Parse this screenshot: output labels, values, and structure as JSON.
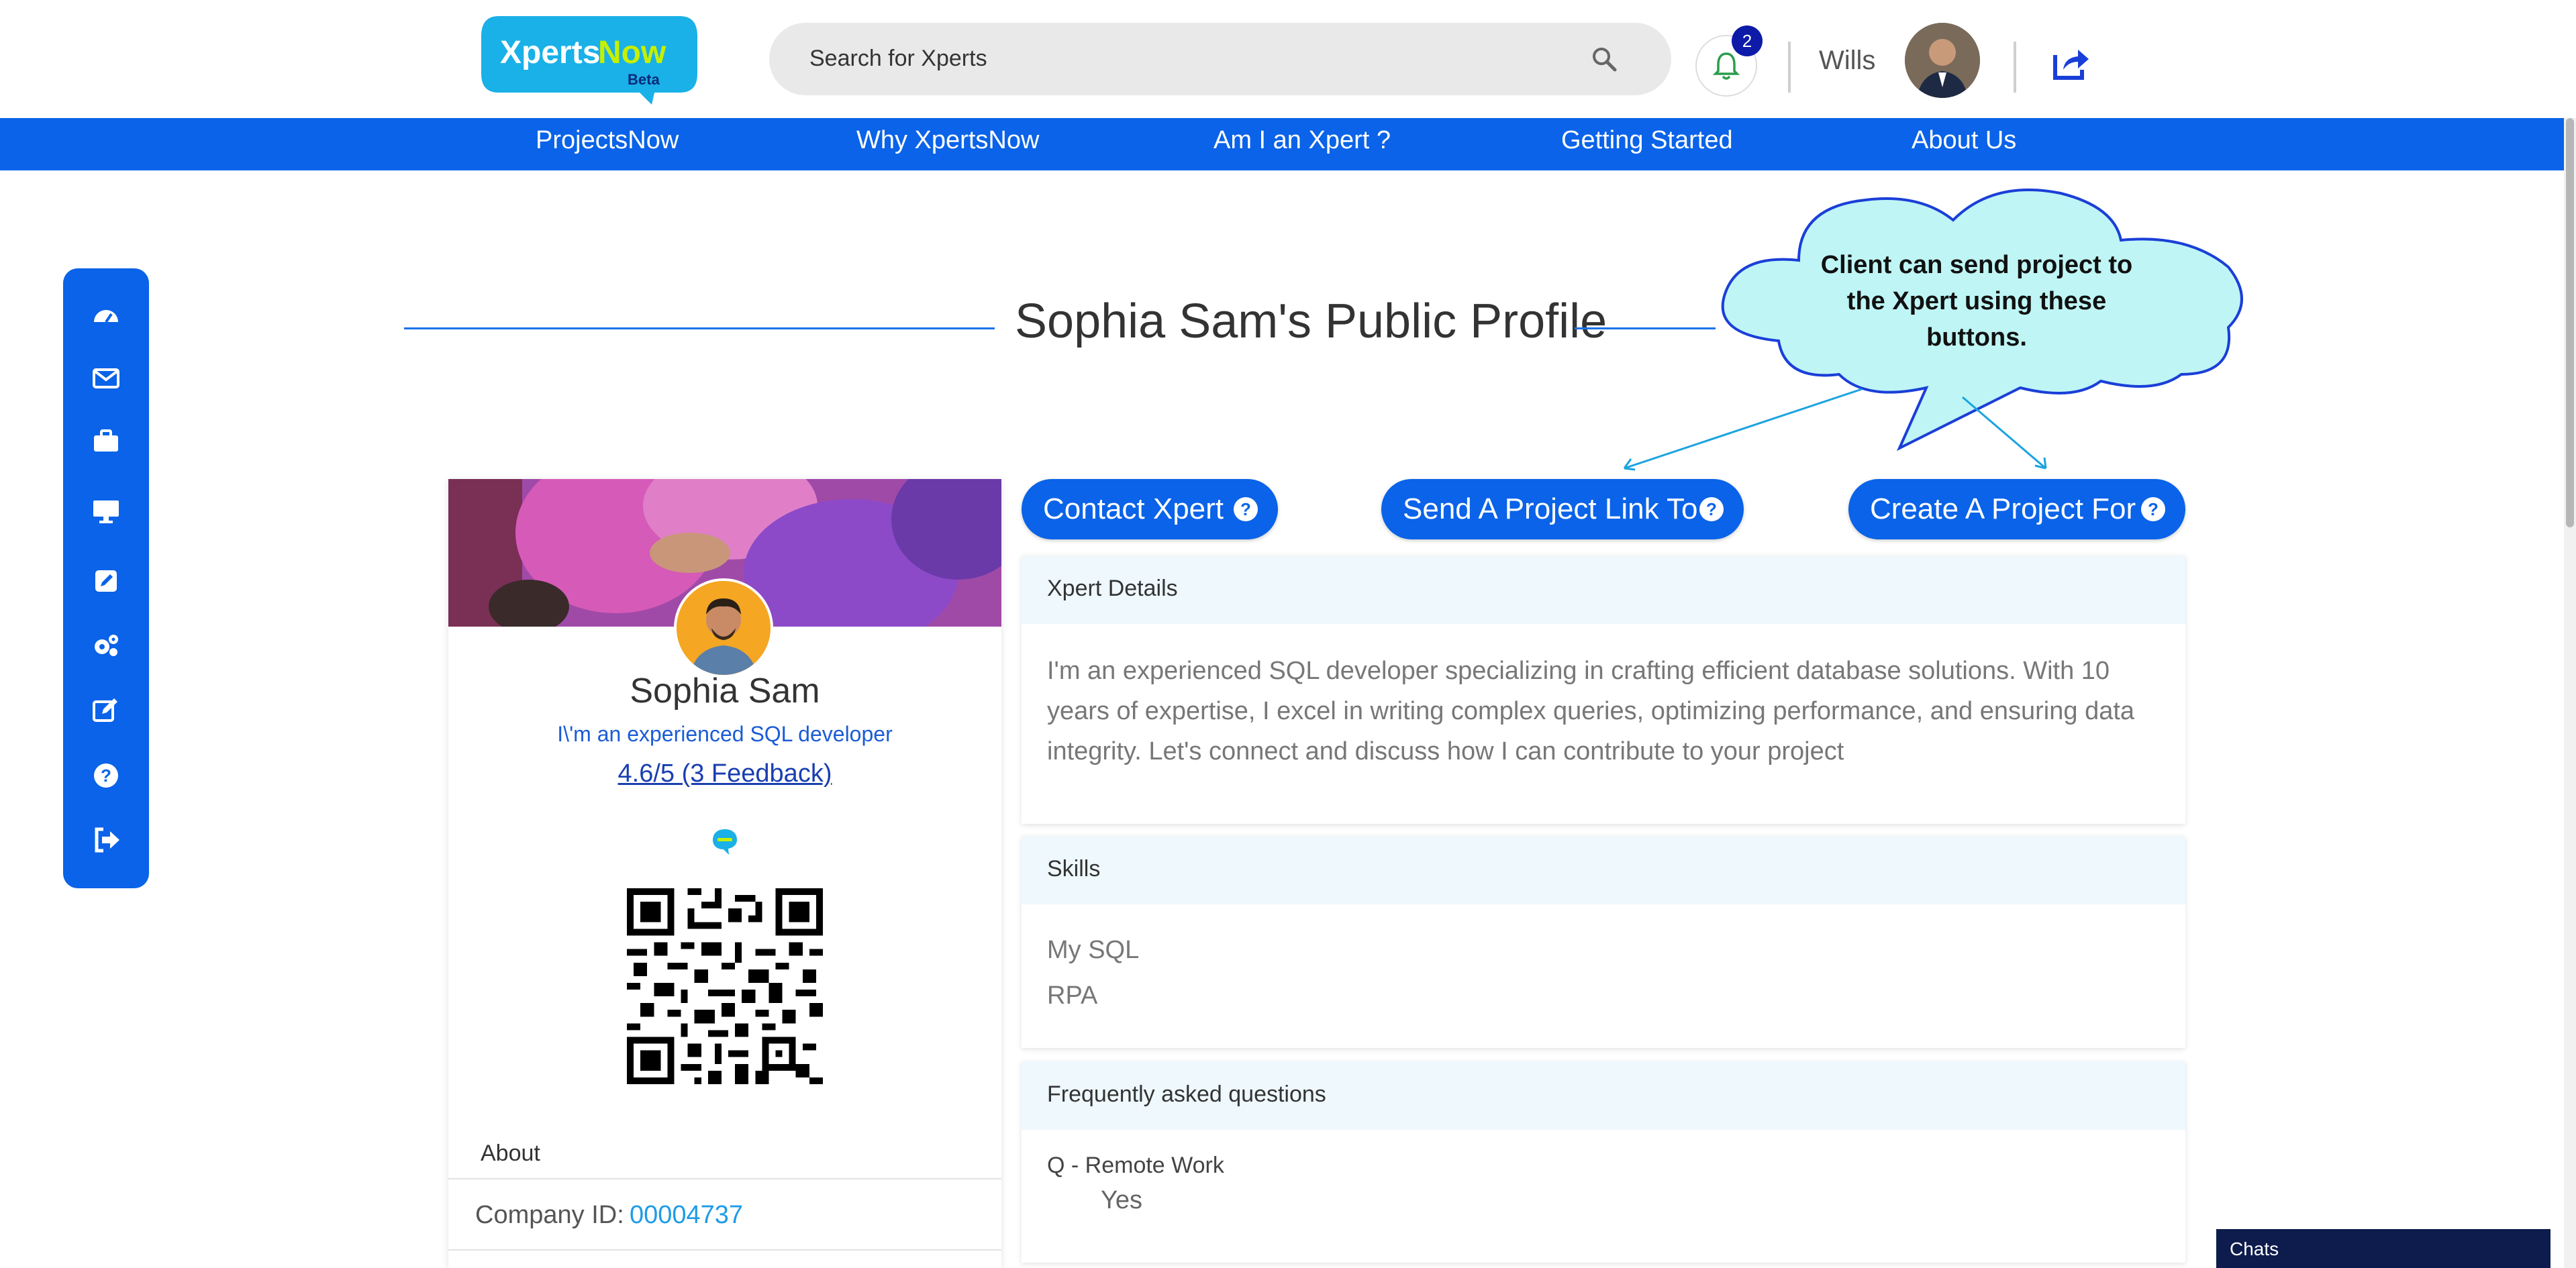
{
  "header": {
    "logo_text": "XpertsNow",
    "logo_badge": "Beta",
    "search_placeholder": "Search for Xperts",
    "notification_count": "2",
    "username": "Wills"
  },
  "nav": {
    "items": [
      "ProjectsNow",
      "Why XpertsNow",
      "Am I an Xpert ?",
      "Getting Started",
      "About Us"
    ]
  },
  "sidebar": {
    "icons": [
      "dashboard-icon",
      "mail-icon",
      "briefcase-icon",
      "desktop-icon",
      "edit-square-icon",
      "gears-icon",
      "edit-icon",
      "help-icon",
      "logout-icon"
    ]
  },
  "page": {
    "title": "Sophia Sam's Public Profile"
  },
  "callout": {
    "text": "Client can send project to the Xpert using these buttons."
  },
  "profile": {
    "name": "Sophia Sam",
    "tagline": "I\\'m an experienced SQL developer",
    "rating": "4.6/5 (3  Feedback)",
    "about_label": "About",
    "company_id_label": "Company ID:",
    "company_id": "00004737"
  },
  "actions": {
    "contact": "Contact Xpert",
    "send_link": "Send A Project Link To",
    "create": "Create A Project For"
  },
  "xpert_details": {
    "heading": "Xpert Details",
    "text": "I'm an experienced SQL developer specializing in crafting efficient database solutions. With 10 years of expertise, I excel in writing complex queries, optimizing performance, and ensuring data integrity. Let's connect and discuss how I can contribute to your project"
  },
  "skills": {
    "heading": "Skills",
    "items": [
      "My SQL",
      "RPA"
    ]
  },
  "faq": {
    "heading": "Frequently asked questions",
    "question": "Q - Remote Work",
    "answer": "Yes"
  },
  "chats": {
    "label": "Chats"
  },
  "colors": {
    "brand_blue": "#0a63e8",
    "cloud_fill": "#bff5f5",
    "panel_head": "#eef8fd"
  }
}
